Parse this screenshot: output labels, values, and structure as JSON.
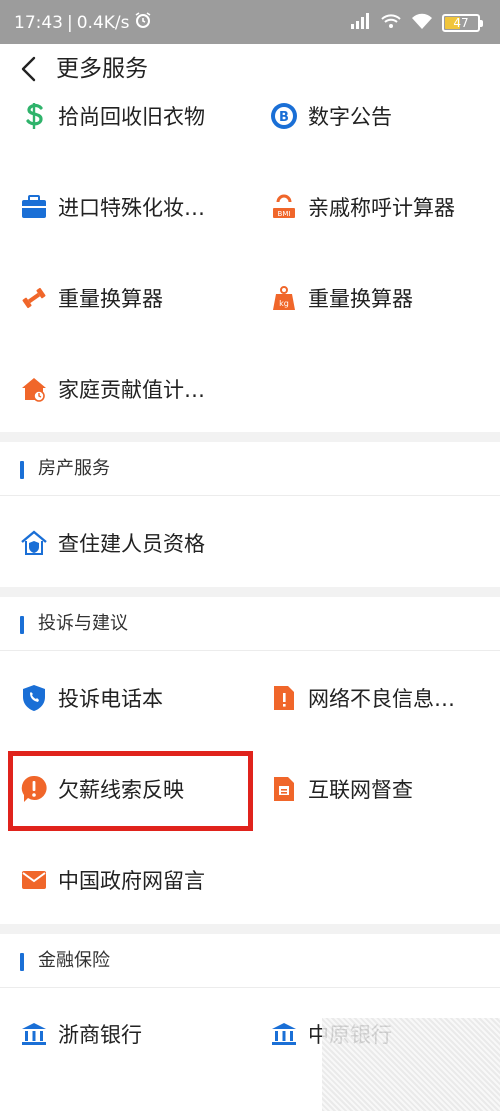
{
  "status_bar": {
    "time": "17:43",
    "separator": "|",
    "speed": "0.4K/s",
    "battery": "47"
  },
  "nav": {
    "title": "更多服务"
  },
  "items": {
    "recycle_clothes": "拾尚回收旧衣物",
    "digital_notice": "数字公告",
    "import_special": "进口特殊化妆…",
    "relative_calc": "亲戚称呼计算器",
    "weight_calc_1": "重量换算器",
    "weight_calc_2": "重量换算器",
    "home_value": "家庭贡献值计…",
    "check_builder": "查住建人员资格",
    "complaint_phone": "投诉电话本",
    "bad_info": "网络不良信息…",
    "wage_arrears": "欠薪线索反映",
    "internet_supervision": "互联网督查",
    "gov_message": "中国政府网留言",
    "zheshang_bank": "浙商银行",
    "zhongyuan_bank": "中原银行"
  },
  "sections": {
    "real_estate": "房产服务",
    "complaints": "投诉与建议",
    "finance": "金融保险"
  },
  "colors": {
    "accent_blue": "#1a6fd6",
    "accent_orange": "#f0662a",
    "highlight_red": "#e0231c",
    "status_bg": "#9c9c9c"
  }
}
